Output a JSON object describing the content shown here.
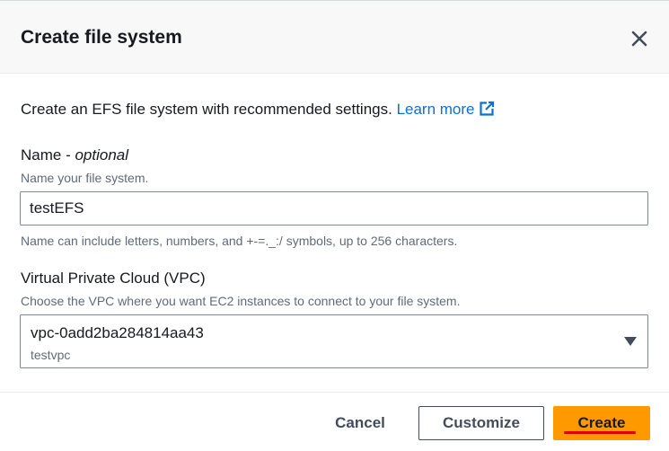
{
  "dialog": {
    "title": "Create file system",
    "close_icon": "close-icon"
  },
  "intro": {
    "text": "Create an EFS file system with recommended settings. ",
    "learn_more": "Learn more",
    "external_icon": "external-link-icon",
    "link_color": "#0972d3"
  },
  "name_field": {
    "label": "Name - ",
    "label_optional": "optional",
    "description": "Name your file system.",
    "value": "testEFS",
    "constraint": "Name can include letters, numbers, and +-=._:/ symbols, up to 256 characters."
  },
  "vpc_field": {
    "label": "Virtual Private Cloud (VPC)",
    "description": "Choose the VPC where you want EC2 instances to connect to your file system.",
    "selected_value": "vpc-0add2ba284814aa43",
    "selected_sub": "testvpc",
    "dropdown_icon": "caret-down-icon"
  },
  "footer": {
    "cancel_label": "Cancel",
    "customize_label": "Customize",
    "create_label": "Create",
    "primary_color": "#ff9900",
    "highlight_color": "#e00000"
  }
}
